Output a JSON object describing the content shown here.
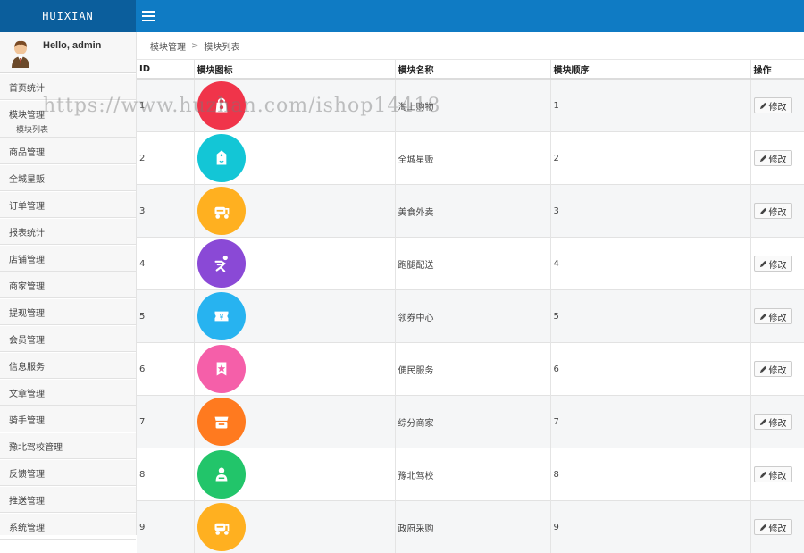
{
  "header": {
    "brand": "HUIXIAN",
    "color": "#0f7bc4",
    "brand_color": "#0b5e9c"
  },
  "user": {
    "greeting": "Hello, admin"
  },
  "sidebar": {
    "items": [
      {
        "label": "首页统计"
      },
      {
        "label": "模块管理",
        "open": true,
        "sub": [
          {
            "label": "模块列表"
          }
        ]
      },
      {
        "label": "商品管理"
      },
      {
        "label": "全城星贩"
      },
      {
        "label": "订单管理"
      },
      {
        "label": "报表统计"
      },
      {
        "label": "店铺管理"
      },
      {
        "label": "商家管理"
      },
      {
        "label": "提现管理"
      },
      {
        "label": "会员管理"
      },
      {
        "label": "信息服务"
      },
      {
        "label": "文章管理"
      },
      {
        "label": "骑手管理"
      },
      {
        "label": "豫北驾校管理"
      },
      {
        "label": "反馈管理"
      },
      {
        "label": "推送管理"
      },
      {
        "label": "系统管理"
      }
    ]
  },
  "breadcrumb": {
    "parent": "模块管理",
    "separator": ">",
    "current": "模块列表"
  },
  "table": {
    "headers": {
      "id": "ID",
      "icon": "模块图标",
      "name": "模块名称",
      "order": "模块顺序",
      "action": "操作"
    },
    "edit_label": "修改",
    "rows": [
      {
        "id": "1",
        "name": "淘上购物",
        "order": "1",
        "icon": "shopping-bag-icon",
        "color": "#f0344a"
      },
      {
        "id": "2",
        "name": "全城星贩",
        "order": "2",
        "icon": "price-tag-icon",
        "color": "#13c6d6"
      },
      {
        "id": "3",
        "name": "美食外卖",
        "order": "3",
        "icon": "scooter-icon",
        "color": "#ffb020"
      },
      {
        "id": "4",
        "name": "跑腿配送",
        "order": "4",
        "icon": "runner-icon",
        "color": "#8a49d6"
      },
      {
        "id": "5",
        "name": "领券中心",
        "order": "5",
        "icon": "coupon-icon",
        "color": "#27b3f0"
      },
      {
        "id": "6",
        "name": "便民服务",
        "order": "6",
        "icon": "star-bookmark-icon",
        "color": "#f55fa9"
      },
      {
        "id": "7",
        "name": "综分商家",
        "order": "7",
        "icon": "store-icon",
        "color": "#ff7a1f"
      },
      {
        "id": "8",
        "name": "豫北驾校",
        "order": "8",
        "icon": "driver-icon",
        "color": "#22c56a"
      },
      {
        "id": "9",
        "name": "政府采购",
        "order": "9",
        "icon": "scooter-icon",
        "color": "#ffb020"
      }
    ]
  },
  "watermark": "https://www.huzhan.com/ishop14418"
}
